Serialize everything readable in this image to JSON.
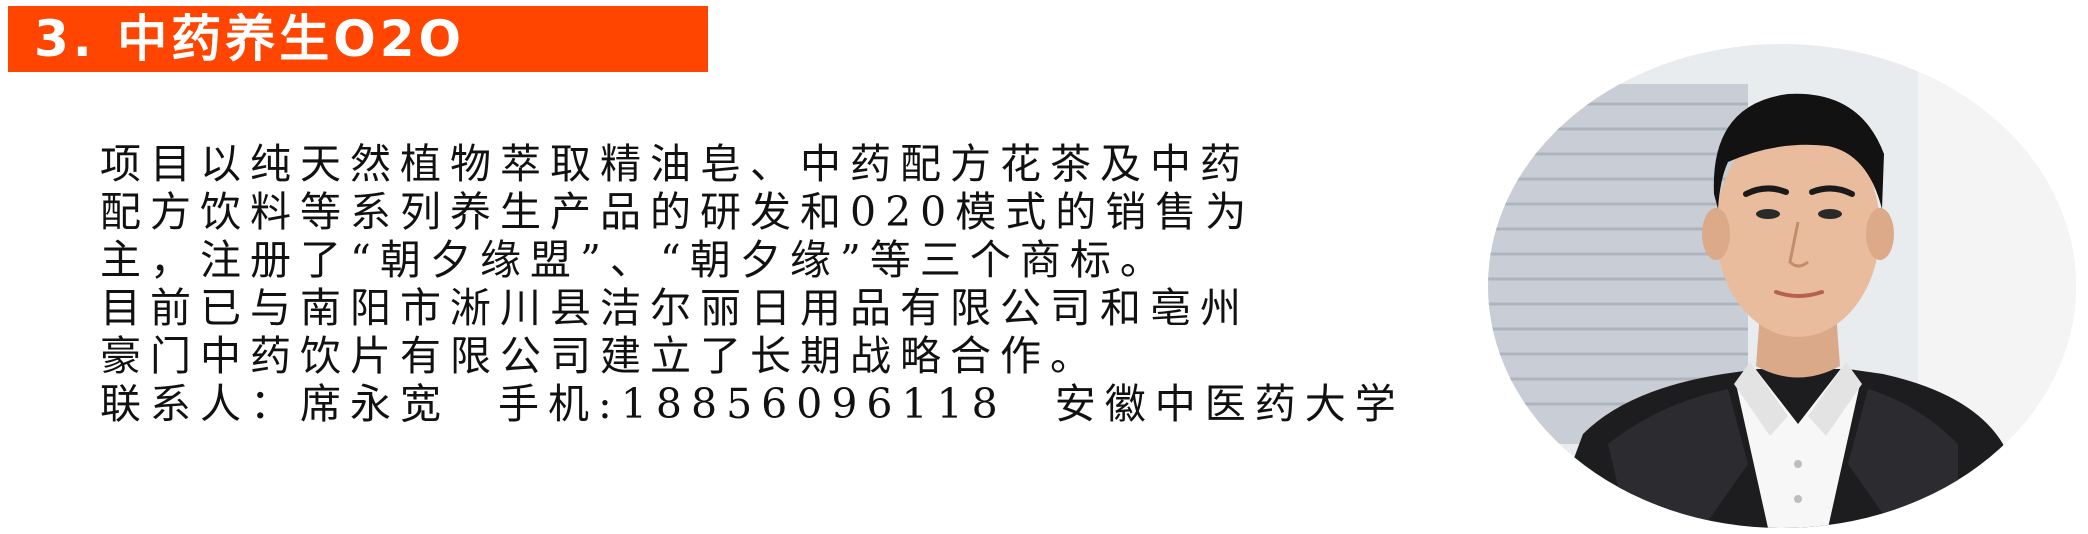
{
  "title": "3. 中药养生O2O",
  "description": {
    "lines": [
      "项目以纯天然植物萃取精油皂、中药配方花茶及中药",
      "配方饮料等系列养生产品的研发和020模式的销售为",
      "主，注册了“朝夕缘盟”、“朝夕缘”等三个商标。",
      "目前已与南阳市淅川县洁尔丽日用品有限公司和亳州",
      "豪门中药饮片有限公司建立了长期战略合作。"
    ]
  },
  "contact": {
    "person": "联系人：席永宽",
    "phone": "手机:18856096118",
    "school": "安徽中医药大学"
  },
  "colors": {
    "banner": "#ff4500",
    "banner_text": "#ffffff",
    "body_text": "#111111"
  }
}
